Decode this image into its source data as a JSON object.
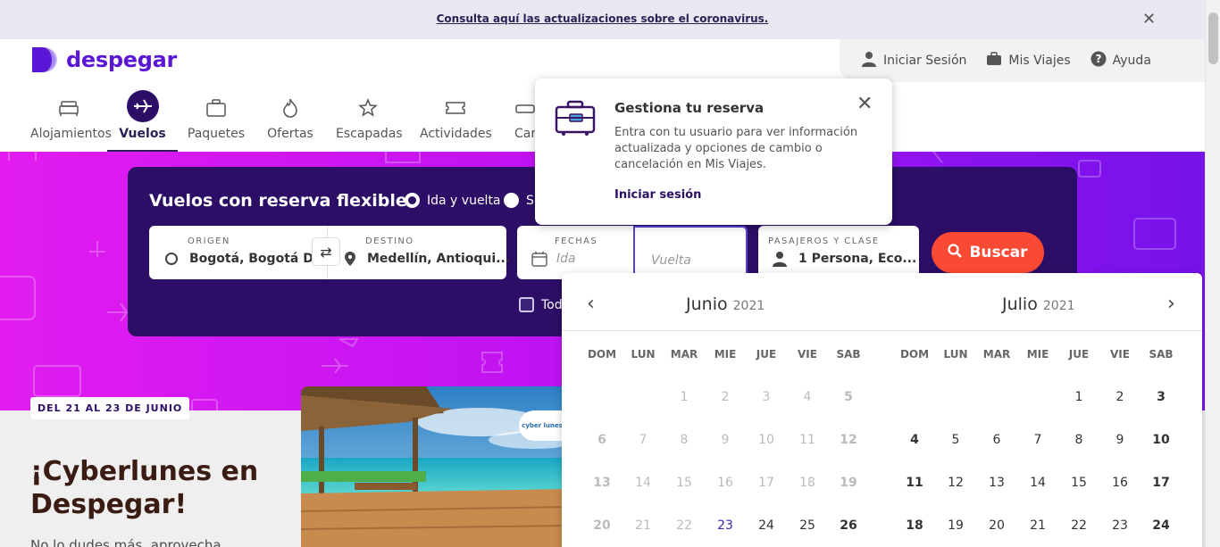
{
  "banner": {
    "text": "Consulta aquí las actualizaciones sobre el coronavirus."
  },
  "brand": {
    "name": "despegar",
    "color": "#5a17d6"
  },
  "user_nav": {
    "login": "Iniciar Sesión",
    "trips": "Mis Viajes",
    "help": "Ayuda"
  },
  "product_nav": {
    "items": [
      {
        "label": "Alojamientos",
        "icon": "bed-icon"
      },
      {
        "label": "Vuelos",
        "icon": "plane-icon",
        "active": true
      },
      {
        "label": "Paquetes",
        "icon": "suitcase-icon"
      },
      {
        "label": "Ofertas",
        "icon": "flame-icon"
      },
      {
        "label": "Escapadas",
        "icon": "star-plane-icon"
      },
      {
        "label": "Actividades",
        "icon": "ticket-icon"
      },
      {
        "label": "Car",
        "icon": "car-icon"
      }
    ]
  },
  "search": {
    "title": "Vuelos con reserva flexible",
    "trip_type": {
      "roundtrip": "Ida y vuelta",
      "oneway_partial": "S"
    },
    "origin": {
      "caption": "ORIGEN",
      "value": "Bogotá, Bogotá D...."
    },
    "destination": {
      "caption": "DESTINO",
      "value": "Medellín, Antioqui..."
    },
    "dates": {
      "caption": "FECHAS",
      "departure_placeholder": "Ida",
      "return_placeholder": "Vuelta"
    },
    "passengers": {
      "caption": "PASAJEROS Y CLASE",
      "value": "1 Persona, Eco..."
    },
    "submit": "Buscar",
    "checkbox_partial": "Tod",
    "accent": "#fa4a34"
  },
  "popover": {
    "title": "Gestiona tu reserva",
    "body": "Entra con tu usuario para ver información actualizada y opciones de cambio o cancelación en Mis Viajes.",
    "link": "Iniciar sesión"
  },
  "calendar": {
    "weekdays": [
      "DOM",
      "LUN",
      "MAR",
      "MIE",
      "JUE",
      "VIE",
      "SAB"
    ],
    "months": [
      {
        "name": "Junio",
        "year": "2021",
        "rows": [
          [
            "",
            "",
            "1",
            "2",
            "3",
            "4",
            "5"
          ],
          [
            "6",
            "7",
            "8",
            "9",
            "10",
            "11",
            "12"
          ],
          [
            "13",
            "14",
            "15",
            "16",
            "17",
            "18",
            "19"
          ],
          [
            "20",
            "21",
            "22",
            "23",
            "24",
            "25",
            "26"
          ]
        ]
      },
      {
        "name": "Julio",
        "year": "2021",
        "rows": [
          [
            "",
            "",
            "",
            "",
            "1",
            "2",
            "3"
          ],
          [
            "4",
            "5",
            "6",
            "7",
            "8",
            "9",
            "10"
          ],
          [
            "11",
            "12",
            "13",
            "14",
            "15",
            "16",
            "17"
          ],
          [
            "18",
            "19",
            "20",
            "21",
            "22",
            "23",
            "24"
          ]
        ]
      }
    ],
    "today": "23"
  },
  "promo": {
    "tag": "DEL 21 AL 23 DE JUNIO",
    "title_line1": "¡Cyberlunes en",
    "title_line2": "Despegar!",
    "subtitle": "No lo dudes más, aprovecha",
    "badge": "cyber lunes"
  }
}
